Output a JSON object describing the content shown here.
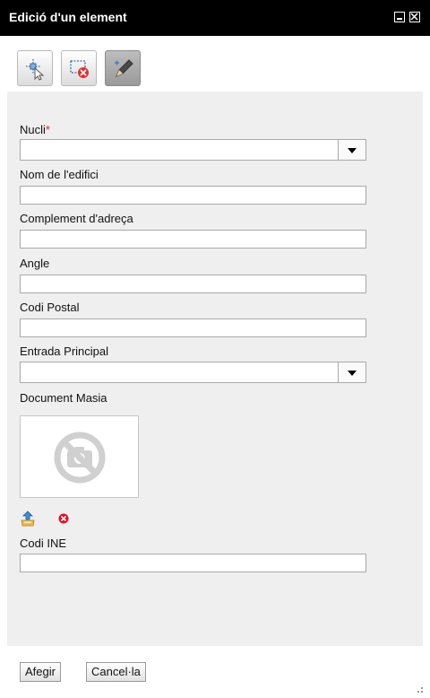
{
  "window": {
    "title": "Edició d'un element"
  },
  "toolbar": {
    "tools": [
      {
        "name": "select-tool",
        "icon": "select-cursor-icon"
      },
      {
        "name": "delete-selection-tool",
        "icon": "delete-selection-icon"
      },
      {
        "name": "edit-tool",
        "icon": "pencil-icon"
      }
    ]
  },
  "form": {
    "nucli": {
      "label": "Nucli",
      "required_mark": "*",
      "value": ""
    },
    "nom_edifici": {
      "label": "Nom de l'edifici",
      "value": ""
    },
    "complement": {
      "label": "Complement d'adreça",
      "value": ""
    },
    "angle": {
      "label": "Angle",
      "value": ""
    },
    "codi_postal": {
      "label": "Codi Postal",
      "value": ""
    },
    "entrada_principal": {
      "label": "Entrada Principal",
      "value": ""
    },
    "document_masia": {
      "label": "Document Masia",
      "icon": "no-photo-icon"
    },
    "codi_ine": {
      "label": "Codi INE",
      "value": ""
    }
  },
  "actions": {
    "add_label": "Afegir",
    "cancel_label": "Cancel·la"
  },
  "colors": {
    "titlebar": "#000000",
    "panel": "#efefef",
    "required": "#dd2222",
    "delete_icon": "#dd1122"
  }
}
